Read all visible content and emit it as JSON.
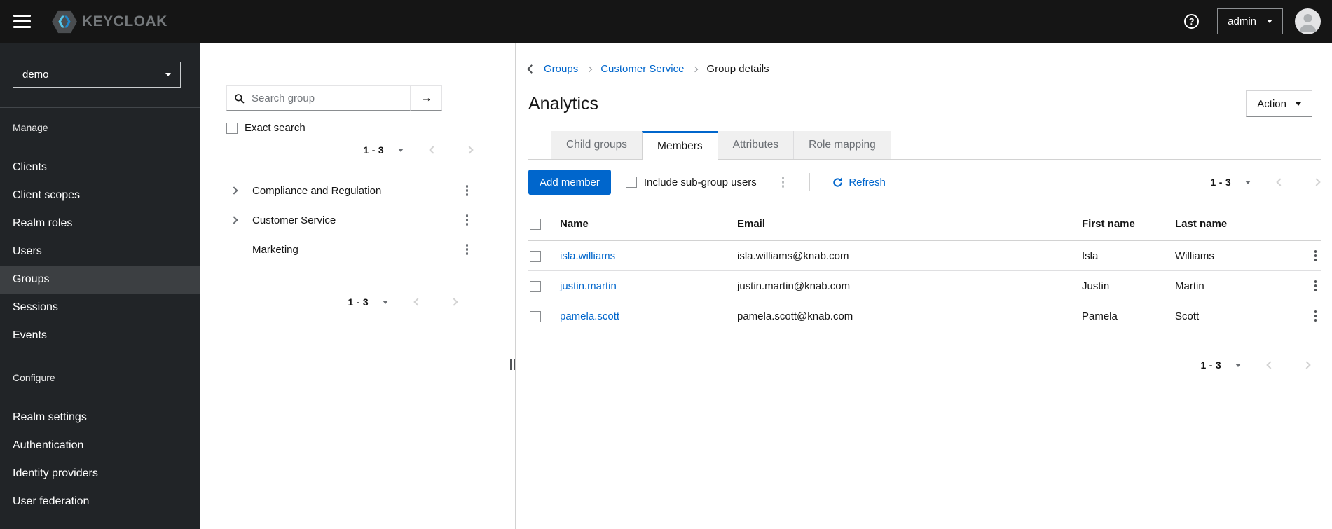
{
  "masthead": {
    "logo_text": "KEYCLOAK",
    "user_label": "admin"
  },
  "icons": {
    "help_glyph": "?",
    "search_submit_arrow": "→"
  },
  "sidebar": {
    "realm": "demo",
    "sections": [
      {
        "label": "Manage",
        "items": [
          {
            "label": "Clients"
          },
          {
            "label": "Client scopes"
          },
          {
            "label": "Realm roles"
          },
          {
            "label": "Users"
          },
          {
            "label": "Groups",
            "active": true
          },
          {
            "label": "Sessions"
          },
          {
            "label": "Events"
          }
        ]
      },
      {
        "label": "Configure",
        "items": [
          {
            "label": "Realm settings"
          },
          {
            "label": "Authentication"
          },
          {
            "label": "Identity providers"
          },
          {
            "label": "User federation"
          }
        ]
      }
    ]
  },
  "group_tree_panel": {
    "search_placeholder": "Search group",
    "exact_search_label": "Exact search",
    "pagination_range": "1 - 3",
    "groups": [
      {
        "name": "Compliance and Regulation",
        "has_children": true
      },
      {
        "name": "Customer Service",
        "has_children": true
      },
      {
        "name": "Marketing",
        "has_children": false
      }
    ],
    "bottom_pagination_range": "1 - 3"
  },
  "main": {
    "breadcrumb": [
      {
        "label": "Groups",
        "link": true
      },
      {
        "label": "Customer Service",
        "link": true
      },
      {
        "label": "Group details",
        "link": false
      }
    ],
    "title": "Analytics",
    "action_label": "Action",
    "tabs": [
      {
        "label": "Child groups"
      },
      {
        "label": "Members",
        "active": true
      },
      {
        "label": "Attributes"
      },
      {
        "label": "Role mapping"
      }
    ],
    "toolbar": {
      "add_member_label": "Add member",
      "include_subgroups_label": "Include sub-group users",
      "refresh_label": "Refresh",
      "pagination_range": "1 - 3"
    },
    "table": {
      "columns": [
        "Name",
        "Email",
        "First name",
        "Last name"
      ],
      "rows": [
        {
          "name": "isla.williams",
          "email": "isla.williams@knab.com",
          "first_name": "Isla",
          "last_name": "Williams"
        },
        {
          "name": "justin.martin",
          "email": "justin.martin@knab.com",
          "first_name": "Justin",
          "last_name": "Martin"
        },
        {
          "name": "pamela.scott",
          "email": "pamela.scott@knab.com",
          "first_name": "Pamela",
          "last_name": "Scott"
        }
      ]
    },
    "bottom_pagination_range": "1 - 3"
  },
  "colors": {
    "primary_blue": "#0066cc",
    "link_blue": "#0066cc",
    "masthead_bg": "#151515",
    "sidebar_bg": "#212427",
    "sidebar_active_bg": "#3c3f42",
    "border": "#d2d2d2",
    "muted_text": "#6a6e73"
  }
}
